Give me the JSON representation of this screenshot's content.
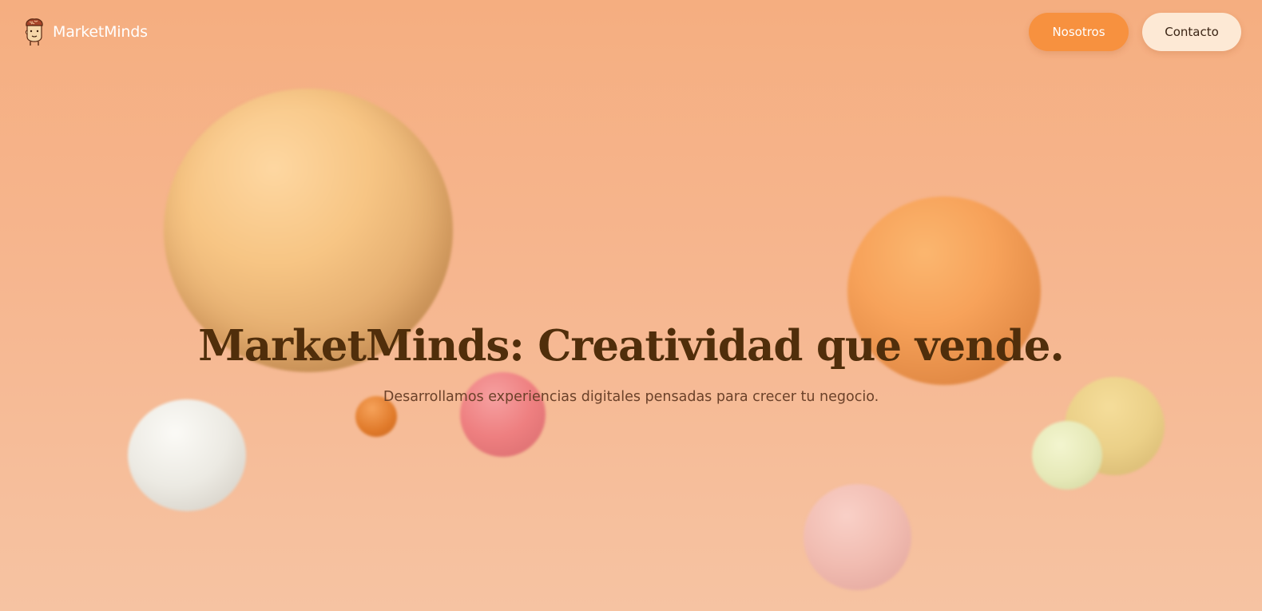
{
  "brand": {
    "name": "MarketMinds",
    "logo_icon": "brain-character-icon"
  },
  "nav": {
    "nosotros_label": "Nosotros",
    "contacto_label": "Contacto"
  },
  "hero": {
    "title": "MarketMinds: Creatividad que vende.",
    "subtitle": "Desarrollamos experiencias digitales pensadas para crecer tu negocio."
  },
  "colors": {
    "background_top": "#f5ae80",
    "background_bottom": "#f6c3a2",
    "primary_button": "#f7913f",
    "secondary_button": "#fde9d5",
    "title_text": "#502e0b",
    "subtitle_text": "#6b4129"
  }
}
